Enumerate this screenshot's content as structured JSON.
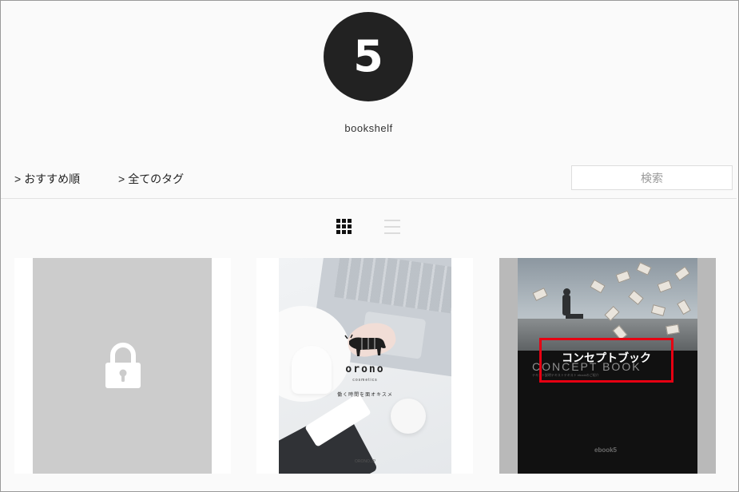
{
  "header": {
    "logo_text": "5",
    "site_name": "bookshelf"
  },
  "nav": {
    "sort_caret": ">",
    "sort_label": "おすすめ順",
    "tags_caret": ">",
    "tags_label": "全てのタグ"
  },
  "search": {
    "placeholder": "検索",
    "value": ""
  },
  "view_toggle": {
    "active": "grid",
    "icons": [
      "grid-view-icon",
      "list-view-icon"
    ]
  },
  "books": [
    {
      "state": "locked",
      "icon": "lock-icon"
    },
    {
      "state": "unlocked",
      "cover_title": "orono",
      "cover_subtitle": "cosmetics",
      "cover_tagline": "働く時間を面オキスメ",
      "cover_footer": "ORONO.JP"
    },
    {
      "state": "unlocked",
      "cover_title": "CONCEPT BOOK",
      "cover_subtitle": "テキスト説明テキストテキスト ebookのご紹介",
      "cover_brand": "ebook5",
      "title_label": "コンセプトブック"
    }
  ],
  "colors": {
    "background": "#fafafa",
    "logo_bg": "#222222",
    "highlight": "#e60012",
    "locked_cover": "#cccccc"
  }
}
